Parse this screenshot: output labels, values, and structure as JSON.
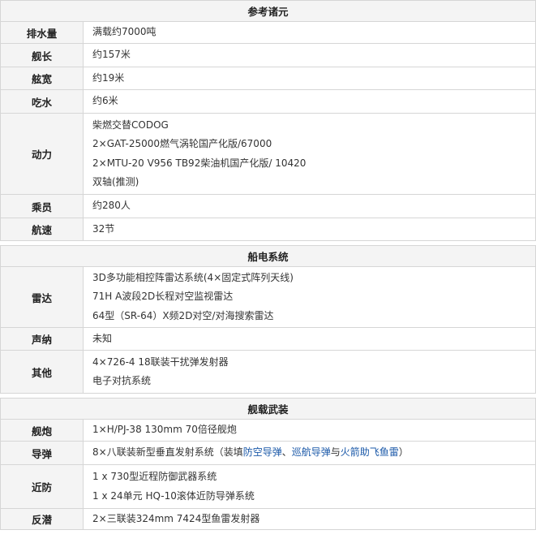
{
  "sections": [
    {
      "title": "参考诸元",
      "rows": [
        {
          "label": "排水量",
          "lines": [
            "满载约7000吨"
          ]
        },
        {
          "label": "舰长",
          "lines": [
            "约157米"
          ]
        },
        {
          "label": "舷宽",
          "lines": [
            "约19米"
          ]
        },
        {
          "label": "吃水",
          "lines": [
            "约6米"
          ]
        },
        {
          "label": "动力",
          "lines": [
            "柴燃交替CODOG",
            "2×GAT-25000燃气涡轮国产化版/67000",
            "2×MTU-20 V956 TB92柴油机国产化版/ 10420",
            "双轴(推测)"
          ]
        },
        {
          "label": "乘员",
          "lines": [
            "约280人"
          ]
        },
        {
          "label": "航速",
          "lines": [
            "32节"
          ]
        }
      ]
    },
    {
      "title": "船电系统",
      "rows": [
        {
          "label": "雷达",
          "lines": [
            "3D多功能相控阵雷达系统(4×固定式阵列天线)",
            "71H A波段2D长程对空监视雷达",
            "64型（SR-64）X频2D对空/对海搜索雷达"
          ]
        },
        {
          "label": "声纳",
          "lines": [
            "未知"
          ]
        },
        {
          "label": "其他",
          "lines": [
            "4×726-4 18联装干扰弹发射器",
            "电子对抗系统"
          ]
        }
      ]
    },
    {
      "title": "舰载武装",
      "rows": [
        {
          "label": "舰炮",
          "lines": [
            "1×H/PJ-38 130mm 70倍径舰炮"
          ]
        },
        {
          "label": "导弹",
          "lines": [
            "8×八联装新型垂直发射系统（装填防空导弹、巡航导弹与火箭助飞鱼雷）"
          ],
          "parts": [
            "8×八联装新型垂直发射系统（装填",
            "防空导弹",
            "、",
            "巡航导弹",
            "与",
            "火箭助飞鱼雷",
            "）"
          ]
        },
        {
          "label": "近防",
          "lines": [
            "1 x 730型近程防御武器系统",
            "1 x 24单元 HQ-10滚体近防导弹系统"
          ]
        },
        {
          "label": "反潜",
          "lines": [
            "2×三联装324mm 7424型鱼雷发射器"
          ]
        }
      ]
    }
  ]
}
